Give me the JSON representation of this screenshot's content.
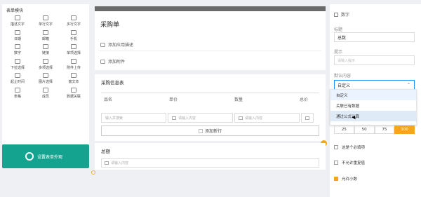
{
  "palette": {
    "title": "表单模块",
    "items": [
      {
        "label": "描述文字",
        "icon": "text-icon"
      },
      {
        "label": "单行文字",
        "icon": "single-line-icon"
      },
      {
        "label": "多行文字",
        "icon": "multi-line-icon"
      },
      {
        "label": "日期",
        "icon": "calendar-icon"
      },
      {
        "label": "邮箱",
        "icon": "mail-icon"
      },
      {
        "label": "手机",
        "icon": "phone-icon"
      },
      {
        "label": "数字",
        "icon": "number-icon"
      },
      {
        "label": "链接",
        "icon": "link-icon"
      },
      {
        "label": "单项选择",
        "icon": "radio-icon"
      },
      {
        "label": "下拉选择",
        "icon": "dropdown-icon"
      },
      {
        "label": "多项选择",
        "icon": "checkbox-icon"
      },
      {
        "label": "附件上传",
        "icon": "attachment-icon"
      },
      {
        "label": "起止时间",
        "icon": "time-range-icon"
      },
      {
        "label": "图片选择",
        "icon": "image-icon"
      },
      {
        "label": "富文本",
        "icon": "richtext-icon"
      },
      {
        "label": "表格",
        "icon": "table-icon"
      },
      {
        "label": "成员",
        "icon": "member-icon"
      },
      {
        "label": "数据关联",
        "icon": "data-link-icon"
      }
    ],
    "promo_label": "设置表单外观"
  },
  "form": {
    "title": "采购单",
    "add_description": "添加应用描述",
    "add_attachment": "添加附件"
  },
  "table": {
    "title": "采购信息表",
    "headers": [
      "品名",
      "单价",
      "数量",
      "总价"
    ],
    "cells": [
      {
        "placeholder": "输入并搜索"
      },
      {
        "placeholder": "请输入内容"
      },
      {
        "placeholder": "请输入内容"
      }
    ],
    "add_row": "添加新行"
  },
  "summary": {
    "title": "总额",
    "placeholder": "请输入内容"
  },
  "panel": {
    "type_label": "数字",
    "title_label": "标题",
    "title_value": "总数",
    "hint_label": "提示",
    "hint_placeholder": "请输入提示",
    "default_label": "默认内容",
    "default_value": "自定义",
    "options": [
      "自定义",
      "关联已有数据",
      "通过公式计算"
    ],
    "widths": [
      "25",
      "50",
      "75",
      "100"
    ],
    "width_selected": "100",
    "checks": [
      {
        "label": "这是个必填项",
        "checked": false
      },
      {
        "label": "不允许重复值",
        "checked": false
      },
      {
        "label": "允许小数",
        "checked": true
      }
    ]
  },
  "colors": {
    "accent": "#f7a61c",
    "promo": "#13a38f",
    "focus": "#1f8fff"
  }
}
